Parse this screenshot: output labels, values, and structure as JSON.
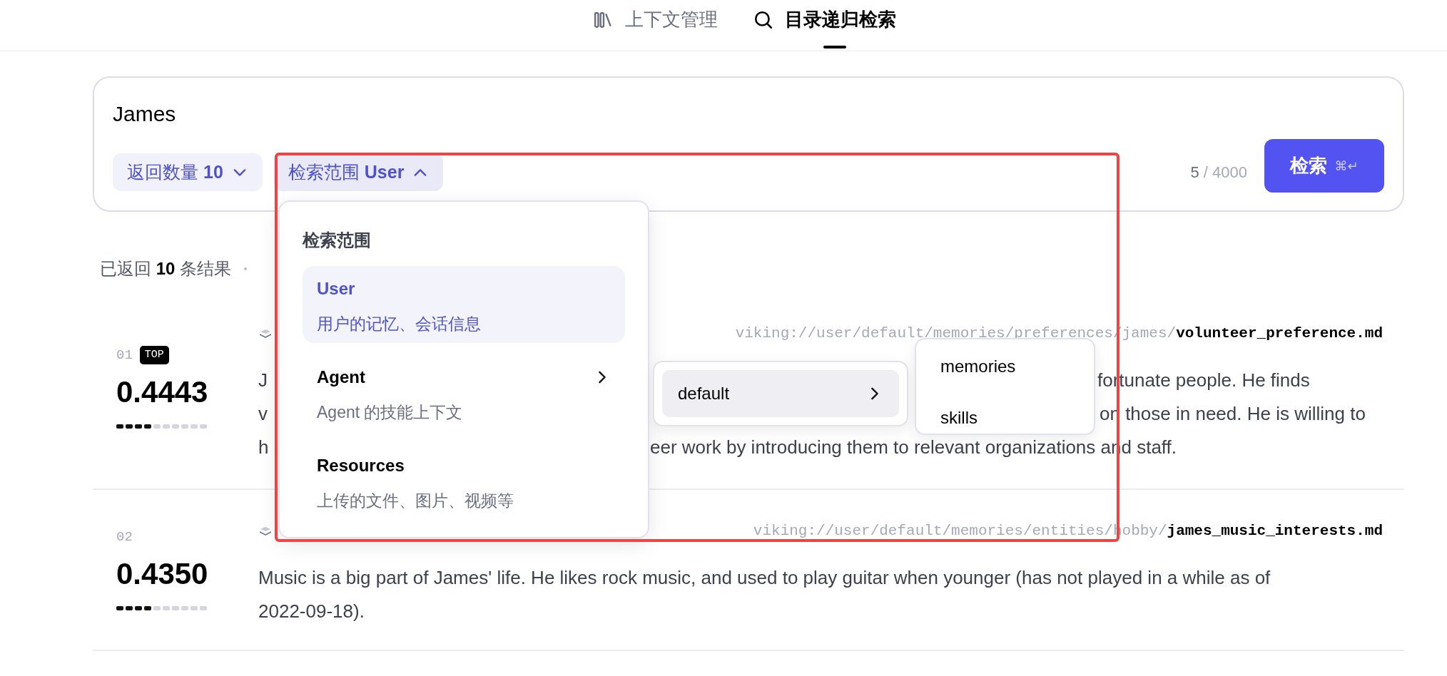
{
  "tabs": [
    {
      "label": "上下文管理",
      "selected": false
    },
    {
      "label": "目录递归检索",
      "selected": true
    }
  ],
  "query": {
    "value": "James"
  },
  "chips": [
    {
      "label": "返回数量",
      "value": "10",
      "expanded": false
    },
    {
      "label": "检索范围",
      "value": "User",
      "expanded": true
    }
  ],
  "char_count": {
    "current": "5",
    "limit": "/ 4000"
  },
  "search_button": {
    "label": "检索",
    "shortcut": "⌘↵"
  },
  "summary": "已返回 **10** 条结果",
  "results": [
    {
      "index": "01",
      "badge": "TOP",
      "score": "0.4443",
      "level": 0.4443,
      "path": "viking://user/default/memories/preferences/james/",
      "file": "volunteer_preference.md",
      "lines": [
        [
          "J",
          "fortunate people. He finds"
        ],
        [
          "v",
          "on those in need. He is willing to"
        ],
        [
          "h",
          "eer work by introducing them to relevant organizations and staff."
        ]
      ]
    },
    {
      "index": "02",
      "score": "0.4350",
      "level": 0.435,
      "path": "viking://user/default/memories/entities/hobby/",
      "file": "james_music_interests.md",
      "lines": [
        [
          "Music is a big part of James' life. He likes rock music, and used to play guitar when younger (has not played in a while as of"
        ],
        [
          "2022-09-18)."
        ]
      ]
    }
  ],
  "scope_menu": {
    "title": "检索范围",
    "items": [
      {
        "label": "User",
        "description": "用户的记忆、会话信息",
        "selected": true,
        "has_submenu": false
      },
      {
        "label": "Agent",
        "description": "Agent 的技能上下文",
        "selected": false,
        "has_submenu": true
      },
      {
        "label": "Resources",
        "description": "上传的文件、图片、视频等",
        "selected": false,
        "has_submenu": false
      }
    ]
  },
  "agent_submenu": {
    "items": [
      {
        "label": "default",
        "selected": true,
        "has_submenu": true
      }
    ]
  },
  "default_submenu": {
    "items": [
      {
        "label": "memories"
      },
      {
        "label": "skills"
      }
    ]
  }
}
